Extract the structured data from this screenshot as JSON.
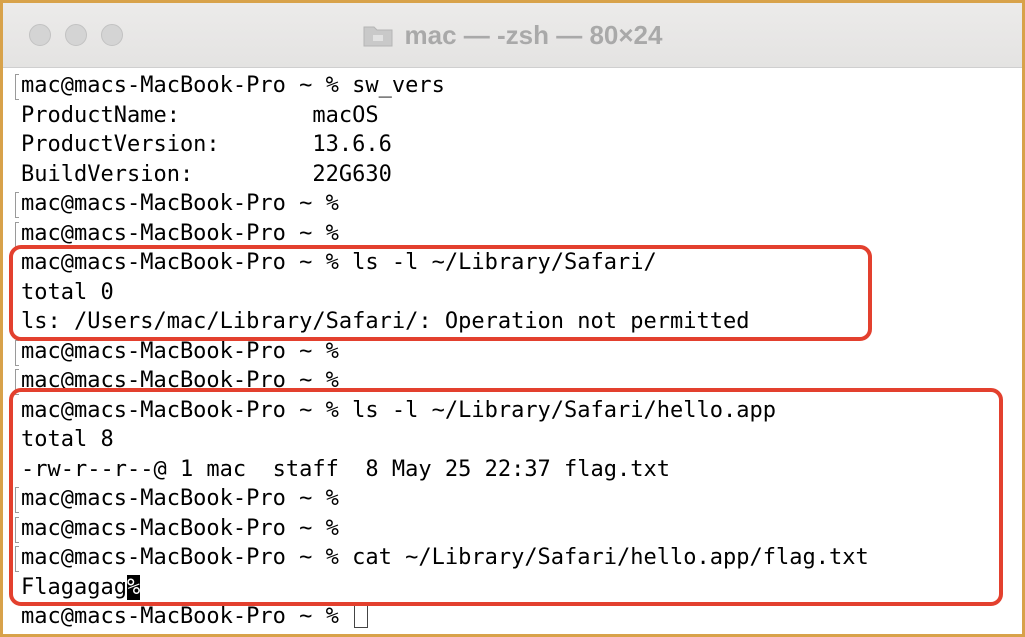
{
  "window": {
    "title": "mac — -zsh — 80×24",
    "accent_color": "#d8a24a"
  },
  "terminal": {
    "lines": [
      {
        "text": "mac@macs-MacBook-Pro ~ % sw_vers",
        "bracket": true
      },
      {
        "text": "ProductName:          macOS",
        "bracket": false
      },
      {
        "text": "ProductVersion:       13.6.6",
        "bracket": false
      },
      {
        "text": "BuildVersion:         22G630",
        "bracket": false
      },
      {
        "text": "mac@macs-MacBook-Pro ~ %",
        "bracket": true
      },
      {
        "text": "mac@macs-MacBook-Pro ~ %",
        "bracket": true
      },
      {
        "text": "mac@macs-MacBook-Pro ~ % ls -l ~/Library/Safari/",
        "bracket": false
      },
      {
        "text": "total 0",
        "bracket": false
      },
      {
        "text": "ls: /Users/mac/Library/Safari/: Operation not permitted",
        "bracket": false
      },
      {
        "text": "mac@macs-MacBook-Pro ~ %",
        "bracket": true
      },
      {
        "text": "mac@macs-MacBook-Pro ~ %",
        "bracket": true
      },
      {
        "text": "mac@macs-MacBook-Pro ~ % ls -l ~/Library/Safari/hello.app",
        "bracket": false
      },
      {
        "text": "total 8",
        "bracket": false
      },
      {
        "text": "-rw-r--r--@ 1 mac  staff  8 May 25 22:37 flag.txt",
        "bracket": false
      },
      {
        "text": "mac@macs-MacBook-Pro ~ %",
        "bracket": true
      },
      {
        "text": "mac@macs-MacBook-Pro ~ %",
        "bracket": true
      },
      {
        "text": "mac@macs-MacBook-Pro ~ % cat ~/Library/Safari/hello.app/flag.txt",
        "bracket": true
      },
      {
        "text": "Flagagag",
        "bracket": false,
        "trailing_inverse": "%"
      },
      {
        "text": "mac@macs-MacBook-Pro ~ % ",
        "bracket": false,
        "cursor": true
      }
    ]
  },
  "annotations": {
    "box_color": "#e3402e"
  }
}
